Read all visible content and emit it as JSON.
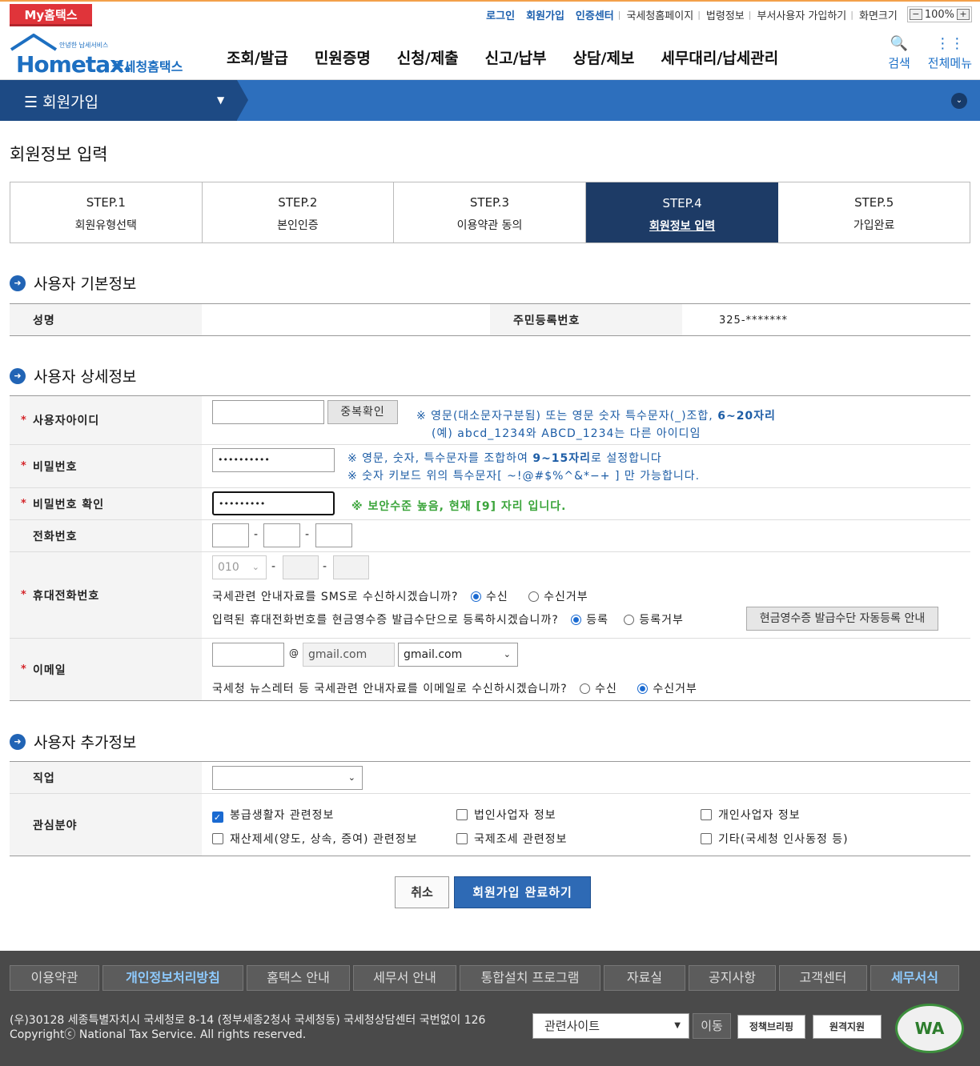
{
  "topbar": {
    "my": "My홈택스",
    "links_bold": [
      "로그인",
      "회원가입",
      "인증센터"
    ],
    "links": [
      "국세청홈페이지",
      "법령정보",
      "부서사용자 가입하기",
      "화면크기"
    ],
    "zoom_minus": "−",
    "zoom": "100%",
    "zoom_plus": "+"
  },
  "header": {
    "logo_small": "안녕한 납세서비스",
    "logo_main": "Hometax.",
    "logo_kr": "국세청홈택스",
    "nav": [
      "조회/발급",
      "민원증명",
      "신청/제출",
      "신고/납부",
      "상담/제보",
      "세무대리/납세관리"
    ],
    "search_icon": "🔍",
    "search": "검색",
    "allmenu_icon": "⋮⋮",
    "allmenu": "전체메뉴"
  },
  "crumb": {
    "menu_icon": "☰",
    "title": "회원가입",
    "caret": "▼",
    "down_icon": "⌄"
  },
  "page_title": "회원정보 입력",
  "steps": [
    {
      "t": "STEP.1",
      "l": "회원유형선택"
    },
    {
      "t": "STEP.2",
      "l": "본인인증"
    },
    {
      "t": "STEP.3",
      "l": "이용약관 동의"
    },
    {
      "t": "STEP.4",
      "l": "회원정보 입력"
    },
    {
      "t": "STEP.5",
      "l": "가입완료"
    }
  ],
  "sections": {
    "basic": "사용자 기본정보",
    "detail": "사용자 상세정보",
    "extra": "사용자 추가정보",
    "icon": "➜"
  },
  "basic": {
    "name_label": "성명",
    "name_value": "",
    "rrn_label": "주민등록번호",
    "rrn_value": "325-*******"
  },
  "detail": {
    "star": "*",
    "id_label": "사용자아이디",
    "id_value": "",
    "dup_btn": "중복확인",
    "id_note1a": "※ 영문(대소문자구분됨) 또는 영문 숫자 특수문자(_)조합, ",
    "id_note1b": "6~20자리",
    "id_note2": "(예) abcd_1234와  ABCD_1234는 다른 아이디임",
    "pw_label": "비밀번호",
    "pw_value": "••••••••••",
    "pw_note1a": "※ 영문, 숫자, 특수문자를 조합하여 ",
    "pw_note1b": "9~15자리",
    "pw_note1c": "로 설정합니다",
    "pw_note2": "※ 숫자 키보드 위의 특수문자[ ~!@#$%^&*−+ ] 만 가능합니다.",
    "pw2_label": "비밀번호 확인",
    "pw2_value": "•••••••••",
    "pw2_note": "※ 보안수준 높음, 현재 [9] 자리 입니다.",
    "tel_label": "전화번호",
    "dash": "-",
    "mobile_label": "휴대전화번호",
    "mobile_prefix": "010",
    "mobile_caret": "⌄",
    "sms_q": "국세관련 안내자료를 SMS로 수신하시겠습니까?",
    "sms_yes": "수신",
    "sms_no": "수신거부",
    "cash_q": "입력된 휴대전화번호를 현금영수증 발급수단으로 등록하시겠습니까?",
    "cash_yes": "등록",
    "cash_no": "등록거부",
    "cash_btn": "현금영수증 발급수단 자동등록 안내",
    "email_label": "이메일",
    "at": "@",
    "email_domain": "gmail.com",
    "email_select": "gmail.com",
    "email_caret": "⌄",
    "email_q": "국세청 뉴스레터 등 국세관련 안내자료를 이메일로 수신하시겠습니까?",
    "email_yes": "수신",
    "email_no": "수신거부"
  },
  "extra": {
    "job_label": "직업",
    "job_value": "",
    "job_caret": "⌄",
    "interest_label": "관심분야",
    "check_mark": "✓",
    "interests": [
      "봉급생활자 관련정보",
      "법인사업자 정보",
      "개인사업자 정보",
      "재산제세(양도, 상속, 증여) 관련정보",
      "국제조세 관련정보",
      "기타(국세청 인사동정 등)"
    ]
  },
  "actions": {
    "cancel": "취소",
    "done": "회원가입 완료하기"
  },
  "footer": {
    "nav": [
      "이용약관",
      "개인정보처리방침",
      "홈택스 안내",
      "세무서 안내",
      "통합설치 프로그램",
      "자료실",
      "공지사항",
      "고객센터",
      "세무서식"
    ],
    "address": "(우)30128 세종특별자치시 국세청로 8-14 (정부세종2청사 국세청동) 국세청상담센터 국번없이 126",
    "copyright": "Copyrightⓒ National Tax Service. All rights reserved.",
    "related": "관련사이트",
    "related_caret": "▼",
    "move": "이동",
    "policy": "정책브리핑",
    "remote": "원격지원",
    "wa": "WA"
  }
}
